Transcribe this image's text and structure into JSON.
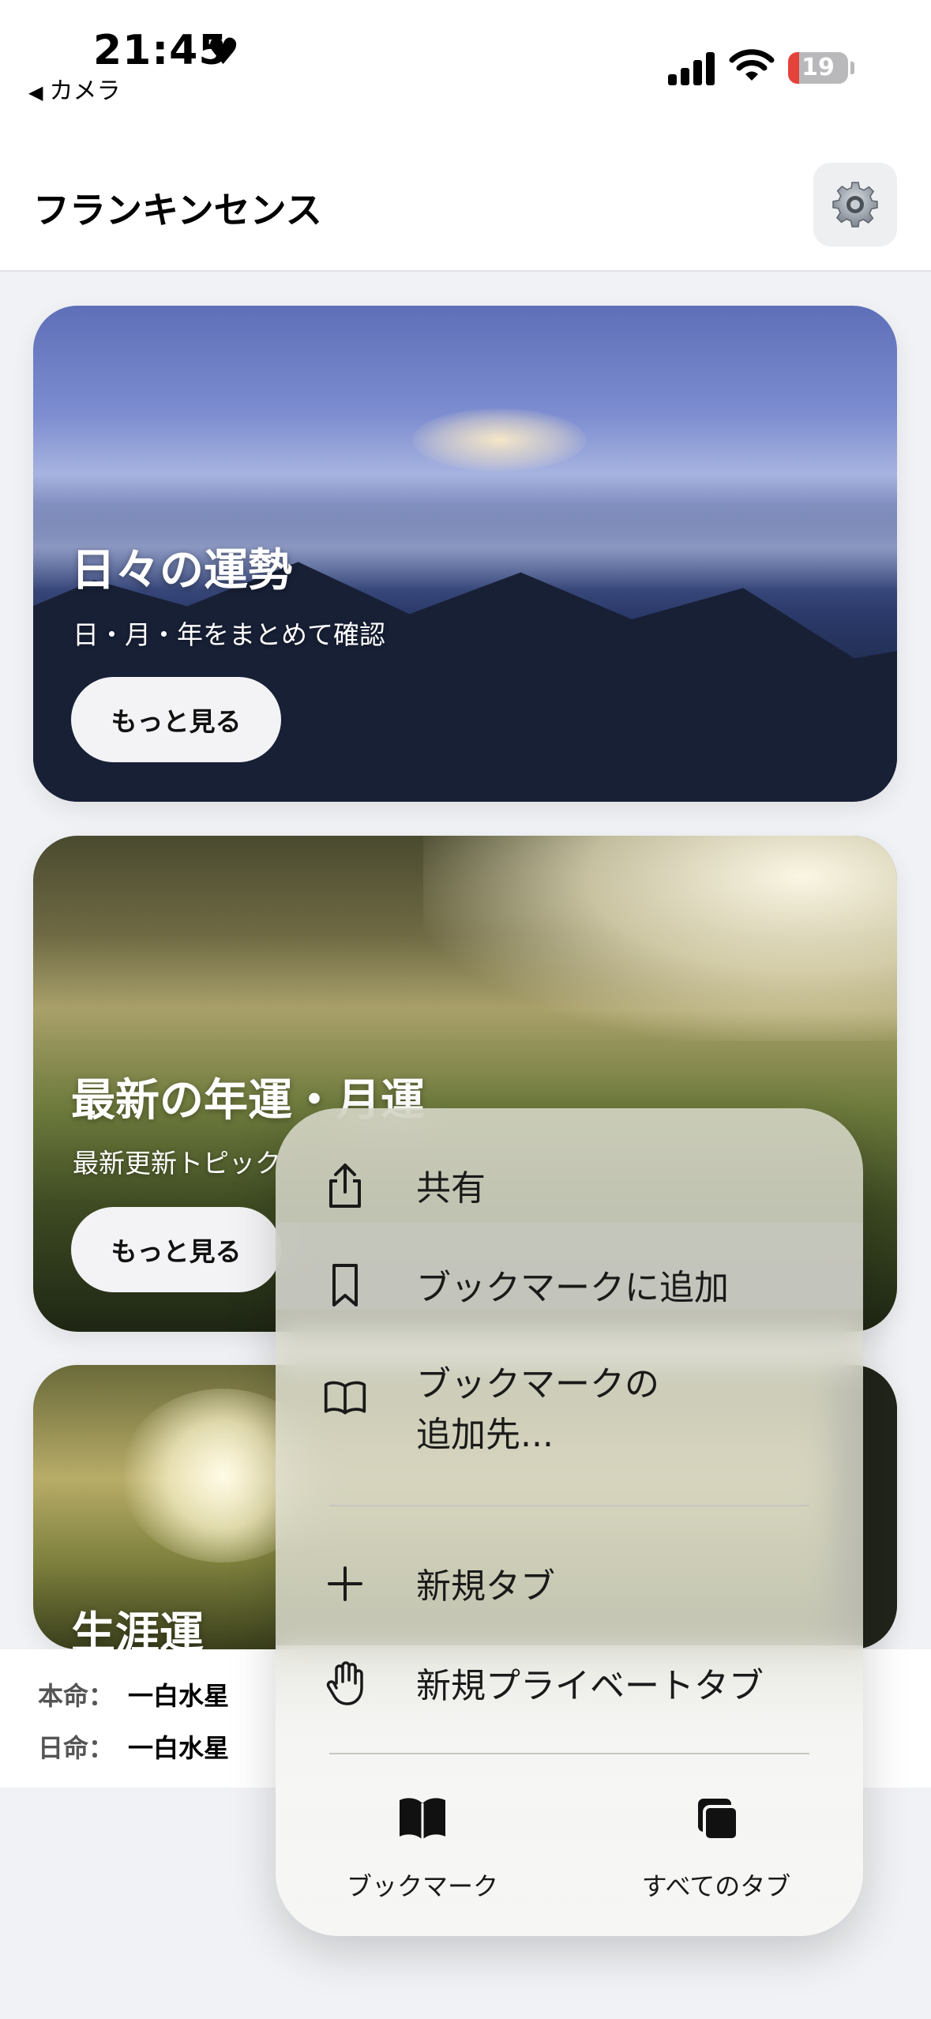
{
  "status_bar": {
    "time": "21:45",
    "back_label": "カメラ",
    "battery_level": "19"
  },
  "header": {
    "title": "フランキンセンス"
  },
  "cards": [
    {
      "title": "日々の運勢",
      "subtitle": "日・月・年をまとめて確認",
      "button": "もっと見る"
    },
    {
      "title": "最新の年運・月運",
      "subtitle": "最新更新トピック",
      "button": "もっと見る"
    },
    {
      "title": "生涯運"
    }
  ],
  "info": {
    "honmei_label": "本命：",
    "honmei_value": "一白水星",
    "nichimei_label": "日命：",
    "nichimei_value": "一白水星"
  },
  "context_menu": {
    "items": [
      {
        "label": "共有",
        "icon": "share-icon"
      },
      {
        "label": "ブックマークに追加",
        "icon": "bookmark-icon"
      },
      {
        "label": "ブックマークの\n追加先...",
        "icon": "book-icon"
      },
      {
        "label": "新規タブ",
        "icon": "plus-icon"
      },
      {
        "label": "新規プライベートタブ",
        "icon": "hand-icon"
      }
    ],
    "bottom": [
      {
        "label": "ブックマーク",
        "icon": "book-fill-icon"
      },
      {
        "label": "すべてのタブ",
        "icon": "tabs-icon"
      }
    ]
  }
}
